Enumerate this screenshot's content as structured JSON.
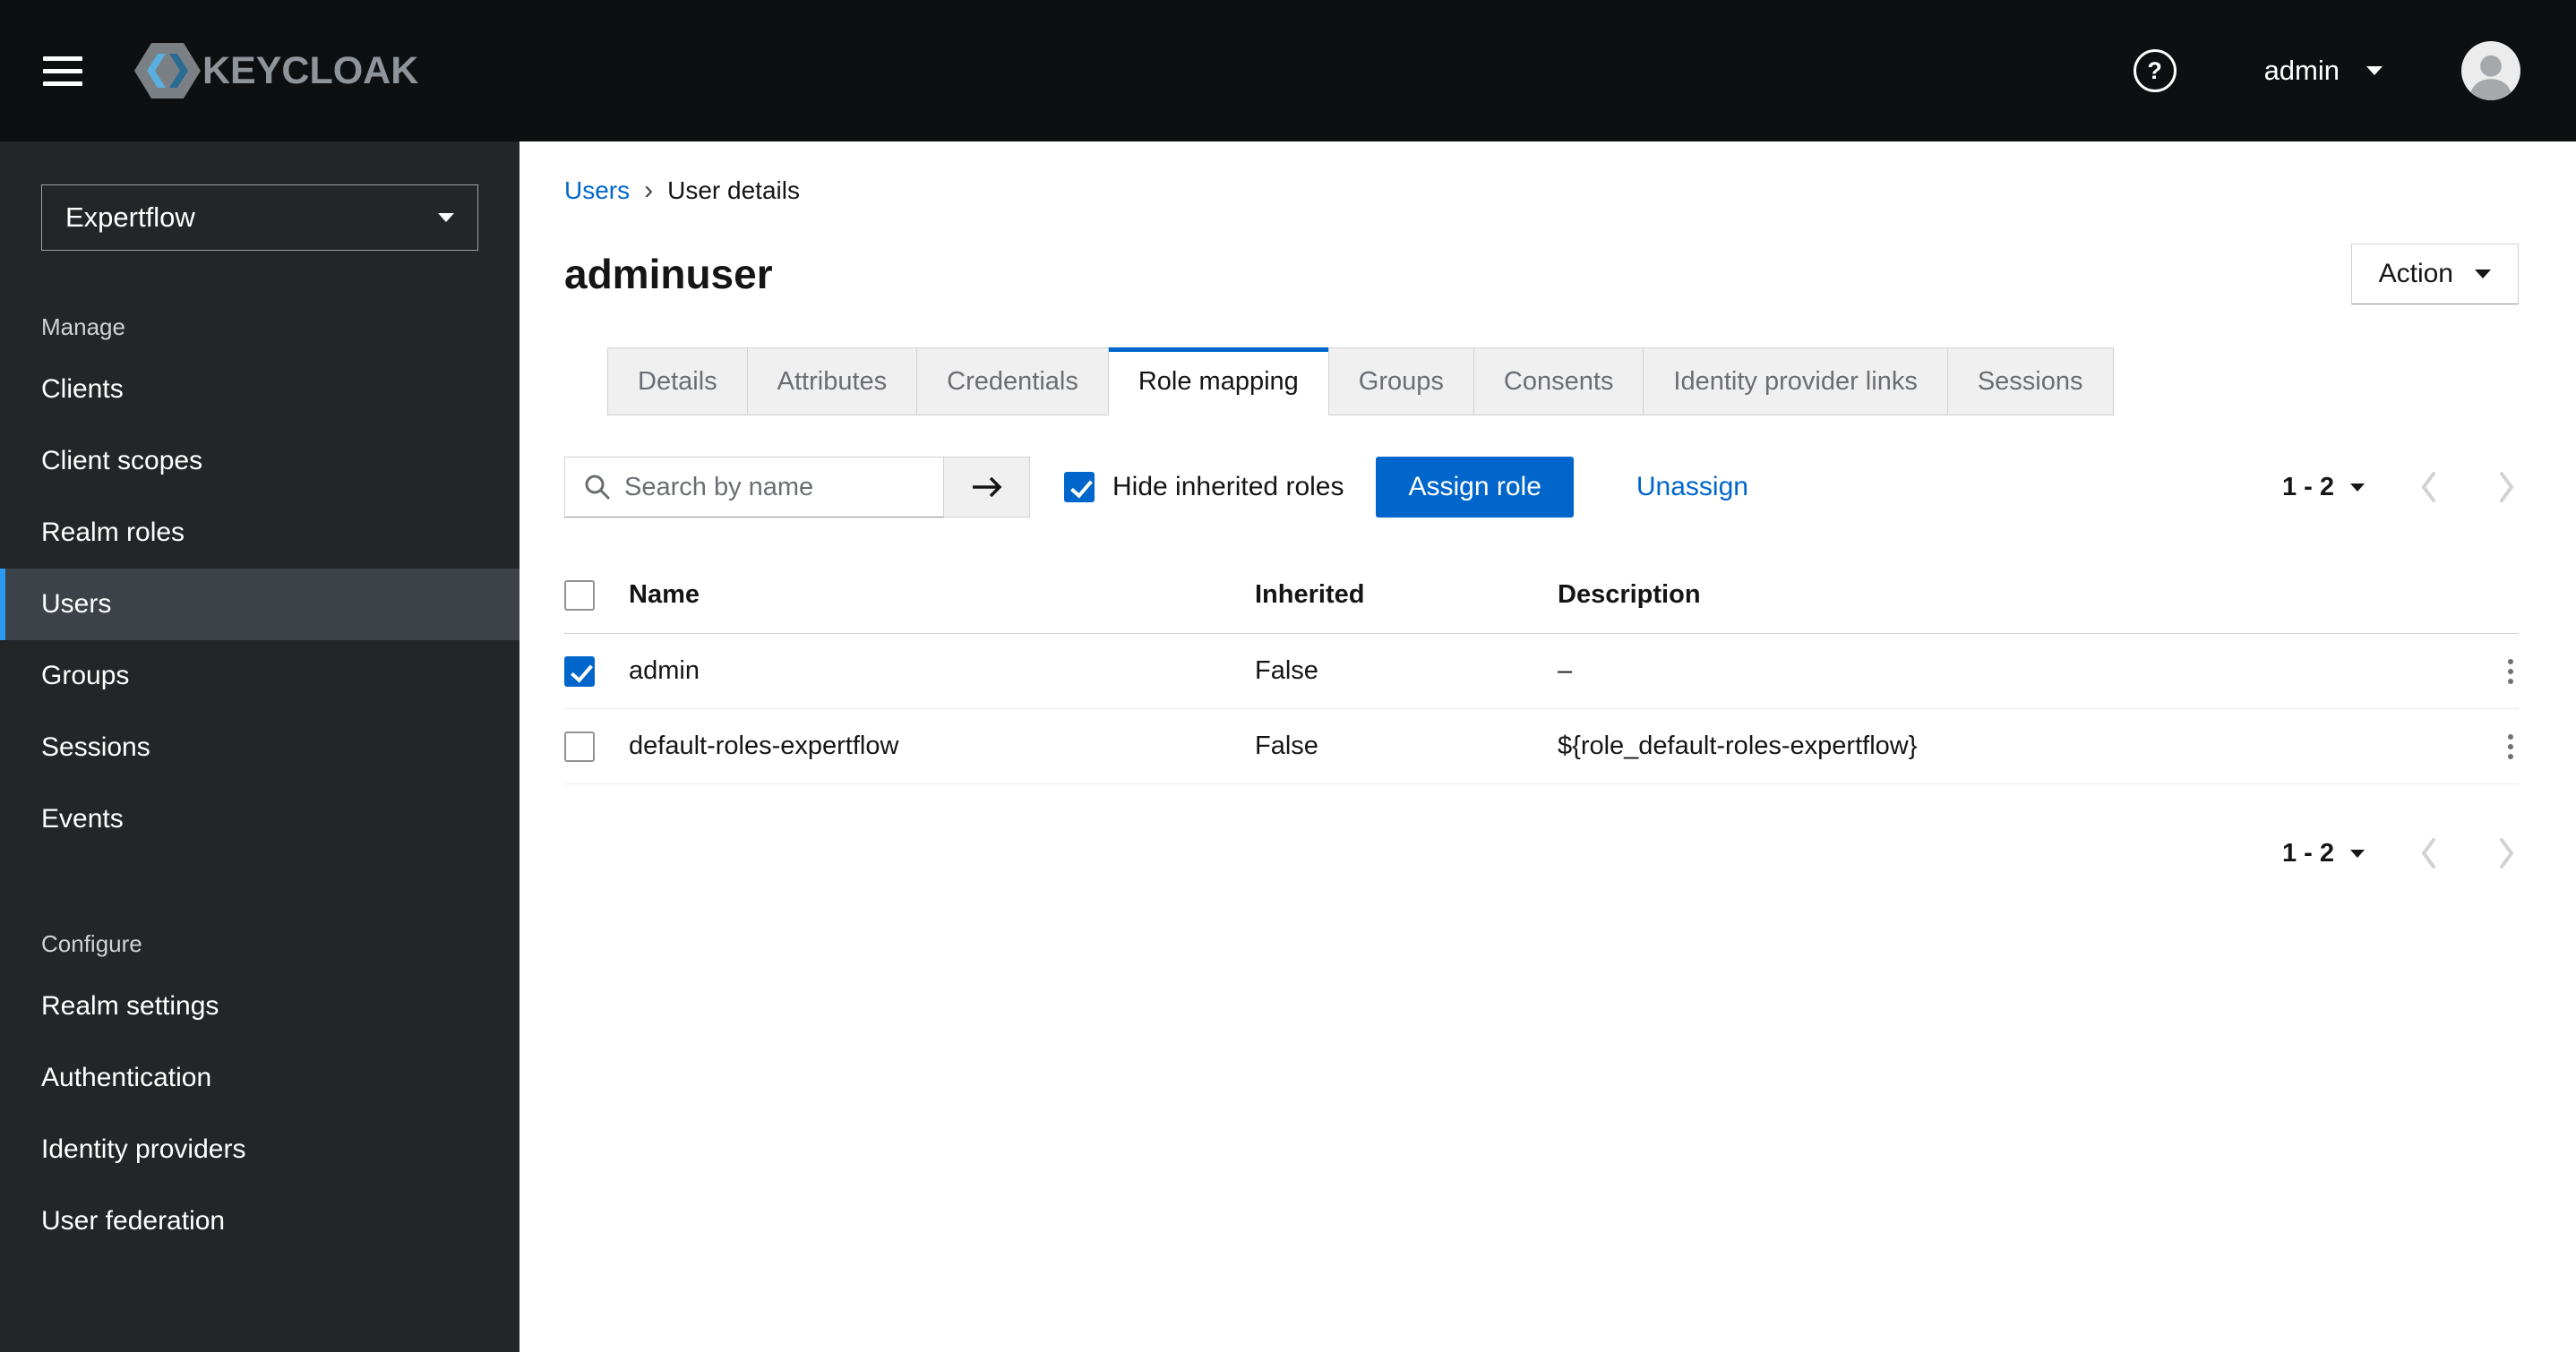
{
  "masthead": {
    "brand": "KEYCLOAK",
    "help_glyph": "?",
    "username": "admin"
  },
  "sidebar": {
    "realm_selector": {
      "value": "Expertflow"
    },
    "sections": [
      {
        "label": "Manage",
        "items": [
          {
            "label": "Clients",
            "current": false
          },
          {
            "label": "Client scopes",
            "current": false
          },
          {
            "label": "Realm roles",
            "current": false
          },
          {
            "label": "Users",
            "current": true
          },
          {
            "label": "Groups",
            "current": false
          },
          {
            "label": "Sessions",
            "current": false
          },
          {
            "label": "Events",
            "current": false
          }
        ]
      },
      {
        "label": "Configure",
        "items": [
          {
            "label": "Realm settings",
            "current": false
          },
          {
            "label": "Authentication",
            "current": false
          },
          {
            "label": "Identity providers",
            "current": false
          },
          {
            "label": "User federation",
            "current": false
          }
        ]
      }
    ]
  },
  "breadcrumb": {
    "separator": "›",
    "items": [
      {
        "label": "Users",
        "link": true
      },
      {
        "label": "User details",
        "link": false
      }
    ]
  },
  "page": {
    "title": "adminuser",
    "action_button": "Action"
  },
  "tabs": [
    {
      "label": "Details",
      "active": false
    },
    {
      "label": "Attributes",
      "active": false
    },
    {
      "label": "Credentials",
      "active": false
    },
    {
      "label": "Role mapping",
      "active": true
    },
    {
      "label": "Groups",
      "active": false
    },
    {
      "label": "Consents",
      "active": false
    },
    {
      "label": "Identity provider links",
      "active": false
    },
    {
      "label": "Sessions",
      "active": false
    }
  ],
  "toolbar": {
    "search_placeholder": "Search by name",
    "hide_inherited_label": "Hide inherited roles",
    "hide_inherited_checked": true,
    "assign_button": "Assign role",
    "unassign_link": "Unassign",
    "pagination": {
      "range": "1 - 2"
    }
  },
  "table": {
    "columns": [
      "Name",
      "Inherited",
      "Description"
    ],
    "rows": [
      {
        "selected": true,
        "name": "admin",
        "inherited": "False",
        "description": "–"
      },
      {
        "selected": false,
        "name": "default-roles-expertflow",
        "inherited": "False",
        "description": "${role_default-roles-expertflow}"
      }
    ]
  },
  "footer_pagination": {
    "range": "1 - 2"
  },
  "colors": {
    "primary": "#0066cc",
    "masthead_bg": "#0d0f11",
    "sidebar_bg": "#222629",
    "selected_nav_bg": "#3c4248",
    "nav_accent": "#2b9af3"
  }
}
